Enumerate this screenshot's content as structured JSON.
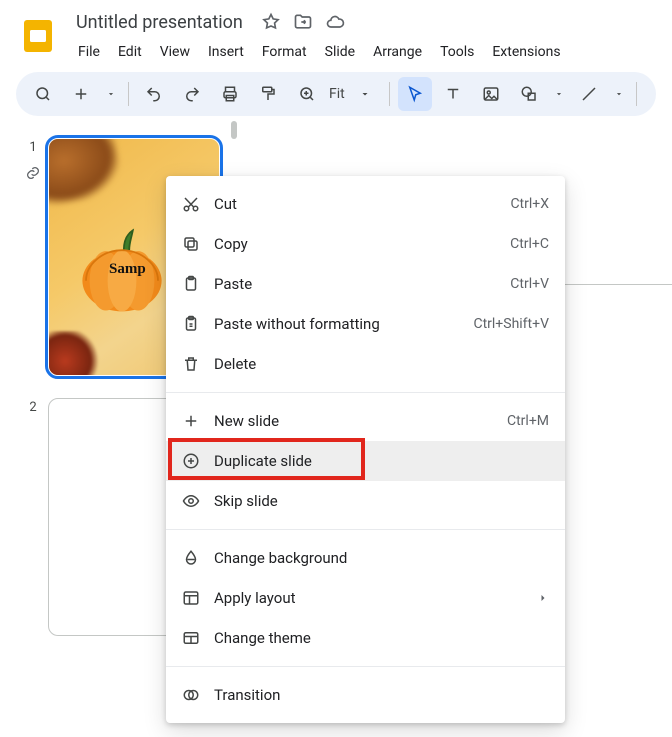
{
  "doc_title": "Untitled presentation",
  "menubar": [
    "File",
    "Edit",
    "View",
    "Insert",
    "Format",
    "Slide",
    "Arrange",
    "Tools",
    "Extensions"
  ],
  "toolbar": {
    "zoom_label": "Fit"
  },
  "slides": {
    "s1_num": "1",
    "s1_sample": "Samp",
    "s2_num": "2"
  },
  "context_menu": {
    "cut": {
      "label": "Cut",
      "shortcut": "Ctrl+X"
    },
    "copy": {
      "label": "Copy",
      "shortcut": "Ctrl+C"
    },
    "paste": {
      "label": "Paste",
      "shortcut": "Ctrl+V"
    },
    "paste_plain": {
      "label": "Paste without formatting",
      "shortcut": "Ctrl+Shift+V"
    },
    "delete": {
      "label": "Delete"
    },
    "new_slide": {
      "label": "New slide",
      "shortcut": "Ctrl+M"
    },
    "duplicate": {
      "label": "Duplicate slide"
    },
    "skip": {
      "label": "Skip slide"
    },
    "change_bg": {
      "label": "Change background"
    },
    "apply_layout": {
      "label": "Apply layout"
    },
    "change_theme": {
      "label": "Change theme"
    },
    "transition": {
      "label": "Transition"
    }
  }
}
